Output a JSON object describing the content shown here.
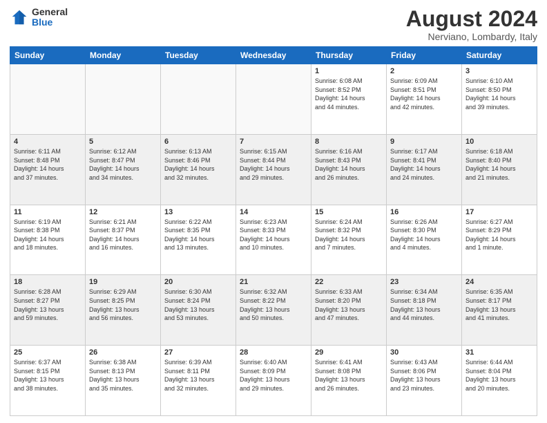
{
  "logo": {
    "general": "General",
    "blue": "Blue"
  },
  "header": {
    "month": "August 2024",
    "location": "Nerviano, Lombardy, Italy"
  },
  "days_of_week": [
    "Sunday",
    "Monday",
    "Tuesday",
    "Wednesday",
    "Thursday",
    "Friday",
    "Saturday"
  ],
  "weeks": [
    [
      {
        "day": "",
        "info": ""
      },
      {
        "day": "",
        "info": ""
      },
      {
        "day": "",
        "info": ""
      },
      {
        "day": "",
        "info": ""
      },
      {
        "day": "1",
        "info": "Sunrise: 6:08 AM\nSunset: 8:52 PM\nDaylight: 14 hours\nand 44 minutes."
      },
      {
        "day": "2",
        "info": "Sunrise: 6:09 AM\nSunset: 8:51 PM\nDaylight: 14 hours\nand 42 minutes."
      },
      {
        "day": "3",
        "info": "Sunrise: 6:10 AM\nSunset: 8:50 PM\nDaylight: 14 hours\nand 39 minutes."
      }
    ],
    [
      {
        "day": "4",
        "info": "Sunrise: 6:11 AM\nSunset: 8:48 PM\nDaylight: 14 hours\nand 37 minutes."
      },
      {
        "day": "5",
        "info": "Sunrise: 6:12 AM\nSunset: 8:47 PM\nDaylight: 14 hours\nand 34 minutes."
      },
      {
        "day": "6",
        "info": "Sunrise: 6:13 AM\nSunset: 8:46 PM\nDaylight: 14 hours\nand 32 minutes."
      },
      {
        "day": "7",
        "info": "Sunrise: 6:15 AM\nSunset: 8:44 PM\nDaylight: 14 hours\nand 29 minutes."
      },
      {
        "day": "8",
        "info": "Sunrise: 6:16 AM\nSunset: 8:43 PM\nDaylight: 14 hours\nand 26 minutes."
      },
      {
        "day": "9",
        "info": "Sunrise: 6:17 AM\nSunset: 8:41 PM\nDaylight: 14 hours\nand 24 minutes."
      },
      {
        "day": "10",
        "info": "Sunrise: 6:18 AM\nSunset: 8:40 PM\nDaylight: 14 hours\nand 21 minutes."
      }
    ],
    [
      {
        "day": "11",
        "info": "Sunrise: 6:19 AM\nSunset: 8:38 PM\nDaylight: 14 hours\nand 18 minutes."
      },
      {
        "day": "12",
        "info": "Sunrise: 6:21 AM\nSunset: 8:37 PM\nDaylight: 14 hours\nand 16 minutes."
      },
      {
        "day": "13",
        "info": "Sunrise: 6:22 AM\nSunset: 8:35 PM\nDaylight: 14 hours\nand 13 minutes."
      },
      {
        "day": "14",
        "info": "Sunrise: 6:23 AM\nSunset: 8:33 PM\nDaylight: 14 hours\nand 10 minutes."
      },
      {
        "day": "15",
        "info": "Sunrise: 6:24 AM\nSunset: 8:32 PM\nDaylight: 14 hours\nand 7 minutes."
      },
      {
        "day": "16",
        "info": "Sunrise: 6:26 AM\nSunset: 8:30 PM\nDaylight: 14 hours\nand 4 minutes."
      },
      {
        "day": "17",
        "info": "Sunrise: 6:27 AM\nSunset: 8:29 PM\nDaylight: 14 hours\nand 1 minute."
      }
    ],
    [
      {
        "day": "18",
        "info": "Sunrise: 6:28 AM\nSunset: 8:27 PM\nDaylight: 13 hours\nand 59 minutes."
      },
      {
        "day": "19",
        "info": "Sunrise: 6:29 AM\nSunset: 8:25 PM\nDaylight: 13 hours\nand 56 minutes."
      },
      {
        "day": "20",
        "info": "Sunrise: 6:30 AM\nSunset: 8:24 PM\nDaylight: 13 hours\nand 53 minutes."
      },
      {
        "day": "21",
        "info": "Sunrise: 6:32 AM\nSunset: 8:22 PM\nDaylight: 13 hours\nand 50 minutes."
      },
      {
        "day": "22",
        "info": "Sunrise: 6:33 AM\nSunset: 8:20 PM\nDaylight: 13 hours\nand 47 minutes."
      },
      {
        "day": "23",
        "info": "Sunrise: 6:34 AM\nSunset: 8:18 PM\nDaylight: 13 hours\nand 44 minutes."
      },
      {
        "day": "24",
        "info": "Sunrise: 6:35 AM\nSunset: 8:17 PM\nDaylight: 13 hours\nand 41 minutes."
      }
    ],
    [
      {
        "day": "25",
        "info": "Sunrise: 6:37 AM\nSunset: 8:15 PM\nDaylight: 13 hours\nand 38 minutes."
      },
      {
        "day": "26",
        "info": "Sunrise: 6:38 AM\nSunset: 8:13 PM\nDaylight: 13 hours\nand 35 minutes."
      },
      {
        "day": "27",
        "info": "Sunrise: 6:39 AM\nSunset: 8:11 PM\nDaylight: 13 hours\nand 32 minutes."
      },
      {
        "day": "28",
        "info": "Sunrise: 6:40 AM\nSunset: 8:09 PM\nDaylight: 13 hours\nand 29 minutes."
      },
      {
        "day": "29",
        "info": "Sunrise: 6:41 AM\nSunset: 8:08 PM\nDaylight: 13 hours\nand 26 minutes."
      },
      {
        "day": "30",
        "info": "Sunrise: 6:43 AM\nSunset: 8:06 PM\nDaylight: 13 hours\nand 23 minutes."
      },
      {
        "day": "31",
        "info": "Sunrise: 6:44 AM\nSunset: 8:04 PM\nDaylight: 13 hours\nand 20 minutes."
      }
    ]
  ]
}
